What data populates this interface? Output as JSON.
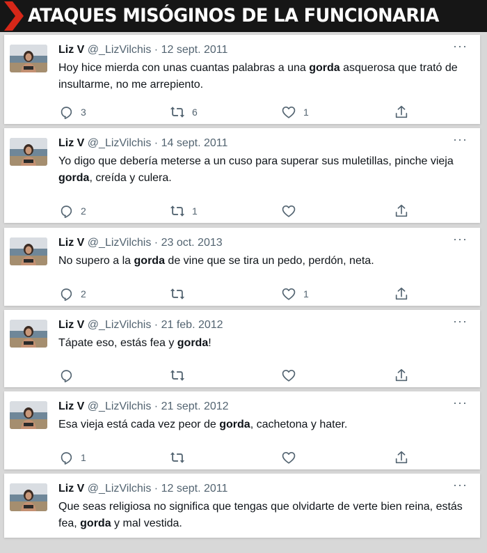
{
  "banner": {
    "title": "ATAQUES MISÓGINOS DE LA FUNCIONARIA"
  },
  "colors": {
    "banner_bg": "#161616",
    "chevron": "#d62718",
    "text": "#0f1419",
    "muted": "#536471"
  },
  "icons": [
    "chevron-right-icon",
    "more-icon",
    "reply-icon",
    "retweet-icon",
    "like-icon",
    "share-icon"
  ],
  "tweets": [
    {
      "name": "Liz V",
      "handle": "@_LizVilchis",
      "sep": "·",
      "date": "12 sept. 2011",
      "text_before": "Hoy hice mierda con unas cuantas palabras a una ",
      "bold": "gorda",
      "text_after": " asquerosa que tratό de insultarme, no me arrepiento.",
      "replies": "3",
      "retweets": "6",
      "likes": "1"
    },
    {
      "name": "Liz V",
      "handle": "@_LizVilchis",
      "sep": "·",
      "date": "14 sept. 2011",
      "text_before": "Yo digo que debería meterse a un cuso para superar sus muletillas, pinche vieja ",
      "bold": "gorda",
      "text_after": ", creída y culera.",
      "replies": "2",
      "retweets": "1",
      "likes": ""
    },
    {
      "name": "Liz V",
      "handle": "@_LizVilchis",
      "sep": "·",
      "date": "23 oct. 2013",
      "text_before": "No supero a la ",
      "bold": "gorda",
      "text_after": " de vine que se tira un pedo, perdón, neta.",
      "replies": "2",
      "retweets": "",
      "likes": "1"
    },
    {
      "name": "Liz V",
      "handle": "@_LizVilchis",
      "sep": "·",
      "date": "21 feb. 2012",
      "text_before": "Tápate eso, estás fea y ",
      "bold": "gorda",
      "text_after": "!",
      "replies": "",
      "retweets": "",
      "likes": ""
    },
    {
      "name": "Liz V",
      "handle": "@_LizVilchis",
      "sep": "·",
      "date": "21 sept. 2012",
      "text_before": "Esa vieja está cada vez peor de ",
      "bold": "gorda",
      "text_after": ", cachetona y hater.",
      "replies": "1",
      "retweets": "",
      "likes": ""
    },
    {
      "name": "Liz V",
      "handle": "@_LizVilchis",
      "sep": "·",
      "date": "12 sept. 2011",
      "text_before": "Que seas religiosa no significa que tengas que olvidarte de verte bien reina, estás fea, ",
      "bold": "gorda",
      "text_after": " y mal vestida.",
      "replies": "",
      "retweets": "",
      "likes": ""
    }
  ]
}
